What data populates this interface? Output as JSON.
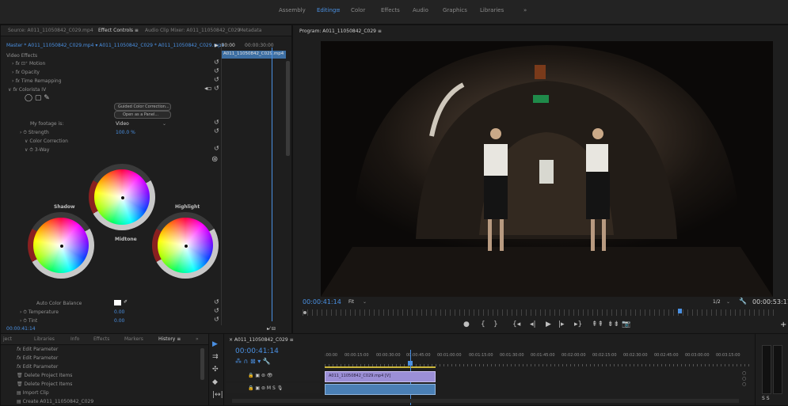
{
  "workspaces": [
    "Assembly",
    "Editing",
    "≡",
    "Color",
    "Effects",
    "Audio",
    "Graphics",
    "Libraries",
    "»"
  ],
  "source_panel": {
    "tabs": [
      "Source: A011_11050842_C029.mp4",
      "Effect Controls ≡",
      "Audio Clip Mixer: A011_11050842_C029",
      "Metadata"
    ],
    "clip_path": "Master * A011_11050842_C029.mp4 ▾  A011_11050842_C029 * A011_11050842_C029.mp4",
    "time_start": "▶ :00:00",
    "time_end": "00:00:30:00",
    "clip_name": "A011_11050842_C029.mp4",
    "video_effects": "Video Effects",
    "motion": "Motion",
    "opacity": "Opacity",
    "time_remapping": "Time Remapping",
    "lumetri": "Colorista IV",
    "guided_btn": "Guided Color Correction...",
    "panel_btn": "Open as a Panel...",
    "footage_label": "My footage is:",
    "footage_value": "Video",
    "strength_label": "Strength",
    "strength_value": "100.0 %",
    "cc_label": "Color Correction",
    "way_label": "3-Way",
    "shadow": "Shadow",
    "midtone": "Midtone",
    "highlight": "Highlight",
    "auto_balance": "Auto Color Balance",
    "temperature_label": "Temperature",
    "temperature_value": "0.00",
    "tint_label": "Tint",
    "tint_value": "0.00",
    "timecode": "00:00:41:14"
  },
  "program": {
    "title": "Program: A011_11050842_C029 ≡",
    "timecode": "00:00:41:14",
    "fit": "Fit",
    "resolution": "1/2",
    "duration": "00:00:53:11"
  },
  "project_panel": {
    "tabs": [
      "ject",
      "Libraries",
      "Info",
      "Effects",
      "Markers",
      "History ≡",
      "»"
    ],
    "history": [
      "Edit Parameter",
      "Edit Parameter",
      "Edit Parameter",
      "Delete Project Items",
      "Delete Project Items",
      "Import Clip",
      "Create A011_11050842_C029"
    ]
  },
  "timeline": {
    "tab": "× A011_11050842_C029 ≡",
    "timecode": "00:00:41:14",
    "ruler": [
      ":00:00",
      "00:00:15:00",
      "00:00:30:00",
      "00:00:45:00",
      "00:01:00:00",
      "00:01:15:00",
      "00:01:30:00",
      "00:01:45:00",
      "00:02:00:00",
      "00:02:15:00",
      "00:02:30:00",
      "00:02:45:00",
      "00:03:00:00",
      "00:03:15:00"
    ],
    "clip_label": "A011_11050842_C029.mp4 [V]"
  },
  "colors": {
    "accent": "#4a90e2",
    "clip": "#9b8fd6",
    "audio": "#4a7fb5"
  }
}
